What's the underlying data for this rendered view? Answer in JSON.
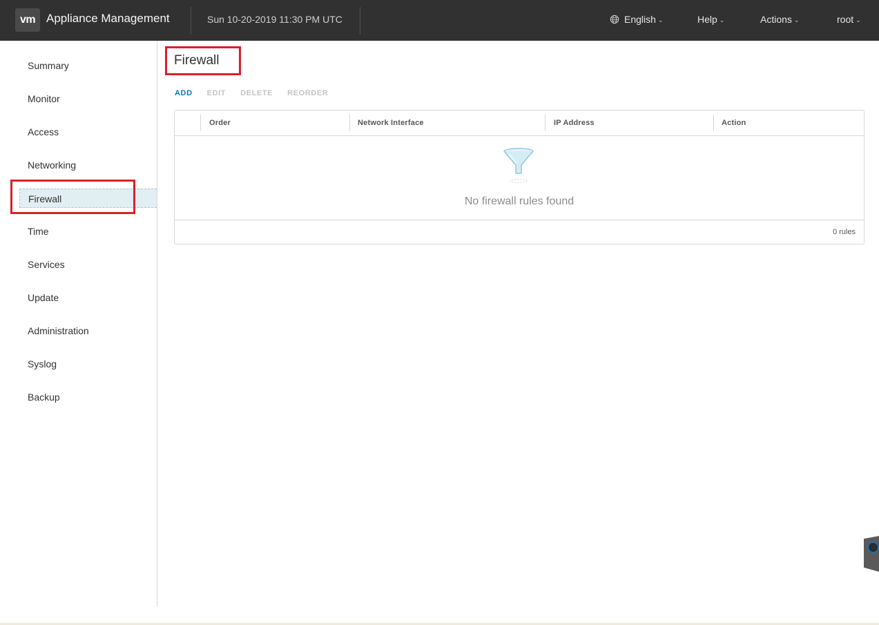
{
  "header": {
    "logo_text": "vm",
    "app_title": "Appliance Management",
    "datetime": "Sun 10-20-2019 11:30 PM UTC",
    "language": "English",
    "help": "Help",
    "actions": "Actions",
    "user": "root"
  },
  "sidebar": {
    "items": [
      {
        "label": "Summary"
      },
      {
        "label": "Monitor"
      },
      {
        "label": "Access"
      },
      {
        "label": "Networking"
      },
      {
        "label": "Firewall"
      },
      {
        "label": "Time"
      },
      {
        "label": "Services"
      },
      {
        "label": "Update"
      },
      {
        "label": "Administration"
      },
      {
        "label": "Syslog"
      },
      {
        "label": "Backup"
      }
    ],
    "active": "Firewall"
  },
  "main": {
    "title": "Firewall",
    "toolbar": {
      "add": "ADD",
      "edit": "EDIT",
      "delete": "DELETE",
      "reorder": "REORDER"
    },
    "grid": {
      "columns": [
        "Order",
        "Network Interface",
        "IP Address",
        "Action"
      ],
      "rows": [],
      "empty_message": "No firewall rules found",
      "footer_count": "0 rules"
    }
  },
  "colors": {
    "header_bg": "#313131",
    "accent": "#0079b8",
    "highlight": "#d9202c",
    "active_item_bg": "#e1eef2"
  },
  "icons": {
    "globe": "globe-icon",
    "chevron": "chevron-down-icon",
    "empty": "funnel-filter-icon"
  }
}
